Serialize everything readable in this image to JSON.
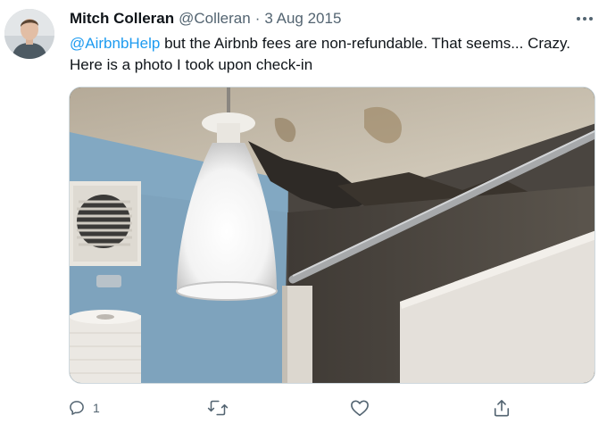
{
  "tweet": {
    "author_name": "Mitch Colleran",
    "handle": "@Colleran",
    "separator": "·",
    "date": "3 Aug 2015",
    "mention": "@AirbnbHelp",
    "text_line1_rest": " but the Airbnb fees are non-refundable. That seems... Crazy.",
    "text_line2": "Here is a photo I took upon check-in"
  },
  "actions": {
    "reply_count": "1",
    "retweet_count": "",
    "like_count": ""
  },
  "icons": {
    "more": "more-dots-icon",
    "reply": "reply-icon",
    "retweet": "retweet-icon",
    "like": "heart-icon",
    "share": "share-icon"
  },
  "colors": {
    "accent": "#1d9bf0",
    "secondary_text": "#536471",
    "primary_text": "#0f1419"
  }
}
